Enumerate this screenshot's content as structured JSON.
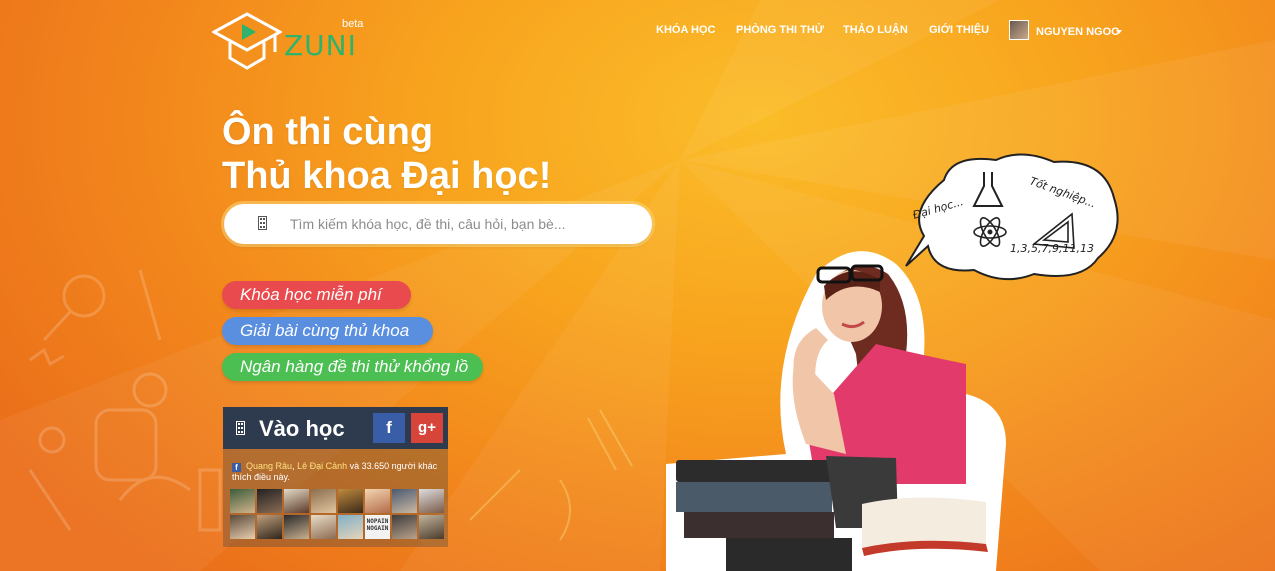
{
  "header": {
    "logo_text": "ZUNI",
    "logo_badge": "beta",
    "nav": [
      "KHÓA HỌC",
      "PHÒNG THI THỬ",
      "THẢO LUẬN",
      "GIỚI THIỆU"
    ],
    "user_name": "NGUYEN NGOC"
  },
  "hero": {
    "headline_line1": "Ôn thi cùng",
    "headline_line2": "Thủ khoa Đại học!",
    "search_placeholder": "Tìm kiếm khóa học, đề thi, câu hỏi, bạn bè...",
    "pills": [
      {
        "label": "Khóa học miễn phí",
        "color": "#e84a4e"
      },
      {
        "label": "Giải bài cùng thủ khoa",
        "color": "#5a8fe0"
      },
      {
        "label": "Ngân hàng đề thi thử khổng lồ",
        "color": "#4cbf52"
      }
    ]
  },
  "login": {
    "title": "Vào học",
    "facebook_label": "f",
    "google_label": "g+",
    "social_friend_1": "Quang Râu",
    "social_friend_2": "Lê Đại Cảnh",
    "social_rest": "và 33.650 người khác thích điều này.",
    "face_label": "NOPAIN NOGAIN"
  },
  "bubble": {
    "word_left": "Đại học...",
    "word_right": "Tốt nghiệp...",
    "numbers": "1,3,5,7,9,11,13"
  },
  "colors": {
    "accent_green": "#2eb26c",
    "facebook": "#3a5da8",
    "google": "#d6443a",
    "login_header": "#2e3b4e"
  },
  "icons": {
    "search": "search-icon",
    "login": "login-icon",
    "user_menu": "chevron-down-icon"
  }
}
